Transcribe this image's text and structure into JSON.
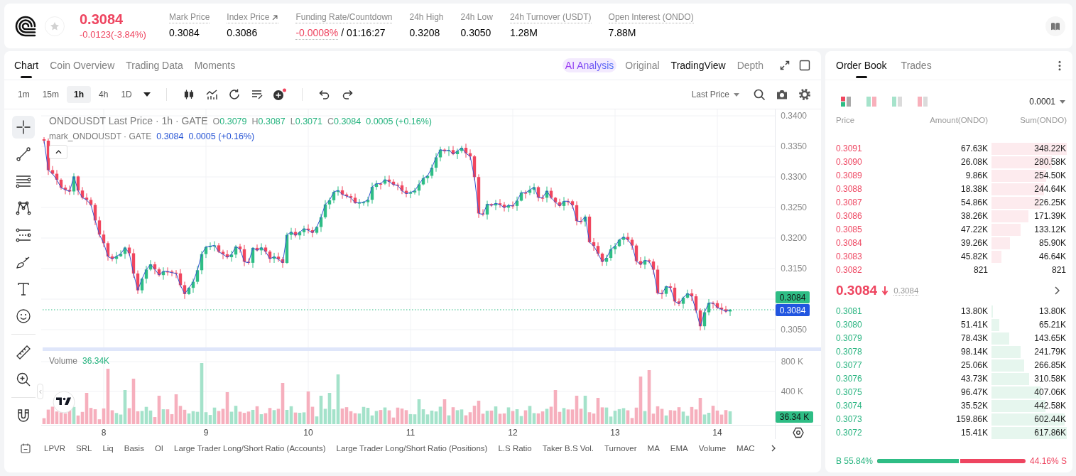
{
  "header": {
    "favorite": false,
    "price": "0.3084",
    "change": "-0.0123(-3.84%)",
    "negative": true,
    "stats": [
      {
        "label": "Mark Price",
        "value": "0.3084",
        "underlined": true,
        "kind": "plain"
      },
      {
        "label": "Index Price",
        "value": "0.3086",
        "underlined": true,
        "kind": "link"
      },
      {
        "label": "Funding Rate/Countdown",
        "value": "-0.0008%",
        "countdown": "/ 01:16:27",
        "underlined": true,
        "kind": "funding"
      },
      {
        "label": "24h High",
        "value": "0.3208",
        "underlined": false,
        "kind": "plain"
      },
      {
        "label": "24h Low",
        "value": "0.3050",
        "underlined": false,
        "kind": "plain"
      },
      {
        "label": "24h Turnover (USDT)",
        "value": "1.28M",
        "underlined": true,
        "kind": "plain"
      },
      {
        "label": "Open Interest (ONDO)",
        "value": "7.88M",
        "underlined": true,
        "kind": "plain"
      }
    ]
  },
  "chart_panel": {
    "tabs": [
      {
        "label": "Chart",
        "selected": true
      },
      {
        "label": "Coin Overview",
        "selected": false
      },
      {
        "label": "Trading Data",
        "selected": false
      },
      {
        "label": "Moments",
        "selected": false
      }
    ],
    "views": [
      {
        "label": "AI Analysis",
        "kind": "ai",
        "selected": false
      },
      {
        "label": "Original",
        "kind": "plain",
        "selected": false
      },
      {
        "label": "TradingView",
        "kind": "plain",
        "selected": true
      },
      {
        "label": "Depth",
        "kind": "plain",
        "selected": false
      }
    ],
    "intervals": [
      {
        "label": "1m",
        "selected": false
      },
      {
        "label": "15m",
        "selected": false
      },
      {
        "label": "1h",
        "selected": true
      },
      {
        "label": "4h",
        "selected": false
      },
      {
        "label": "1D",
        "selected": false
      }
    ],
    "price_source": "Last Price",
    "drawing_tool_groups": [
      {
        "tools": [
          {
            "kind": "crosshair",
            "selected": true
          },
          {
            "kind": "trend-line",
            "selected": false
          },
          {
            "kind": "parallel-lines",
            "selected": false
          },
          {
            "kind": "pattern",
            "selected": false
          },
          {
            "kind": "fib",
            "selected": false
          },
          {
            "kind": "brush",
            "selected": false
          },
          {
            "kind": "text",
            "selected": false
          },
          {
            "kind": "emoji",
            "selected": false
          }
        ]
      },
      {
        "tools": [
          {
            "kind": "ruler",
            "selected": false
          },
          {
            "kind": "zoom",
            "selected": false
          }
        ]
      },
      {
        "tools": [
          {
            "kind": "magnet",
            "selected": false
          }
        ]
      }
    ],
    "legend": {
      "title": "ONDOUSDT Last Price · 1h · GATE",
      "negative": false,
      "ohlc": [
        {
          "key": "O",
          "value": "0.3079"
        },
        {
          "key": "H",
          "value": "0.3087"
        },
        {
          "key": "L",
          "value": "0.3071"
        },
        {
          "key": "C",
          "value": "0.3084"
        }
      ],
      "change": "0.0005 (+0.16%)"
    },
    "mark_legend": {
      "title": "mark_ONDOUSDT · GATE",
      "value": "0.3084",
      "change": "0.0005 (+0.16%)"
    },
    "price_axis": {
      "ticks": [
        "0.3400",
        "0.3350",
        "0.3300",
        "0.3250",
        "0.3200",
        "0.3150",
        "0.3050"
      ],
      "last_price": "0.3084",
      "mark_price": "0.3084"
    },
    "volume": {
      "label": "Volume",
      "value": "36.34K",
      "ticks": [
        "800 K",
        "400 K"
      ],
      "last": "36.34 K"
    },
    "time_axis": [
      "8",
      "9",
      "10",
      "11",
      "12",
      "13",
      "14"
    ],
    "indicators": [
      "LPVR",
      "SRL",
      "Liq",
      "Basis",
      "OI",
      "Large Trader Long/Short Ratio (Accounts)",
      "Large Trader Long/Short Ratio (Positions)",
      "L.S Ratio",
      "Taker B.S Vol.",
      "Turnover",
      "MA",
      "EMA",
      "Volume",
      "MAC"
    ]
  },
  "order_book": {
    "tabs": [
      {
        "label": "Order Book",
        "selected": true
      },
      {
        "label": "Trades",
        "selected": false
      }
    ],
    "layouts": [
      {
        "kind": "both",
        "selected": true
      },
      {
        "kind": "split",
        "selected": false
      },
      {
        "kind": "bids",
        "selected": false
      },
      {
        "kind": "asks",
        "selected": false
      }
    ],
    "precision": "0.0001",
    "columns": [
      "Price",
      "Amount(ONDO)",
      "Sum(ONDO)"
    ],
    "asks": [
      {
        "price": "0.3091",
        "amount": "67.63K",
        "sum": "348.22K"
      },
      {
        "price": "0.3090",
        "amount": "26.08K",
        "sum": "280.58K"
      },
      {
        "price": "0.3089",
        "amount": "9.86K",
        "sum": "254.50K"
      },
      {
        "price": "0.3088",
        "amount": "18.38K",
        "sum": "244.64K"
      },
      {
        "price": "0.3087",
        "amount": "54.86K",
        "sum": "226.25K"
      },
      {
        "price": "0.3086",
        "amount": "38.26K",
        "sum": "171.39K"
      },
      {
        "price": "0.3085",
        "amount": "47.22K",
        "sum": "133.12K"
      },
      {
        "price": "0.3084",
        "amount": "39.26K",
        "sum": "85.90K"
      },
      {
        "price": "0.3083",
        "amount": "45.82K",
        "sum": "46.64K"
      },
      {
        "price": "0.3082",
        "amount": "821",
        "sum": "821"
      }
    ],
    "last": {
      "price": "0.3084",
      "negative": true,
      "mark": "0.3084"
    },
    "bids": [
      {
        "price": "0.3081",
        "amount": "13.80K",
        "sum": "13.80K"
      },
      {
        "price": "0.3080",
        "amount": "51.41K",
        "sum": "65.21K"
      },
      {
        "price": "0.3079",
        "amount": "78.43K",
        "sum": "143.65K"
      },
      {
        "price": "0.3078",
        "amount": "98.14K",
        "sum": "241.79K"
      },
      {
        "price": "0.3077",
        "amount": "25.06K",
        "sum": "266.85K"
      },
      {
        "price": "0.3076",
        "amount": "43.73K",
        "sum": "310.58K"
      },
      {
        "price": "0.3075",
        "amount": "96.47K",
        "sum": "407.06K"
      },
      {
        "price": "0.3074",
        "amount": "35.52K",
        "sum": "442.58K"
      },
      {
        "price": "0.3073",
        "amount": "159.86K",
        "sum": "602.44K"
      },
      {
        "price": "0.3072",
        "amount": "15.41K",
        "sum": "617.86K"
      }
    ],
    "ratio": {
      "buy": "B 55.84%",
      "sell": "44.16% S",
      "level": 0.5584
    }
  }
}
